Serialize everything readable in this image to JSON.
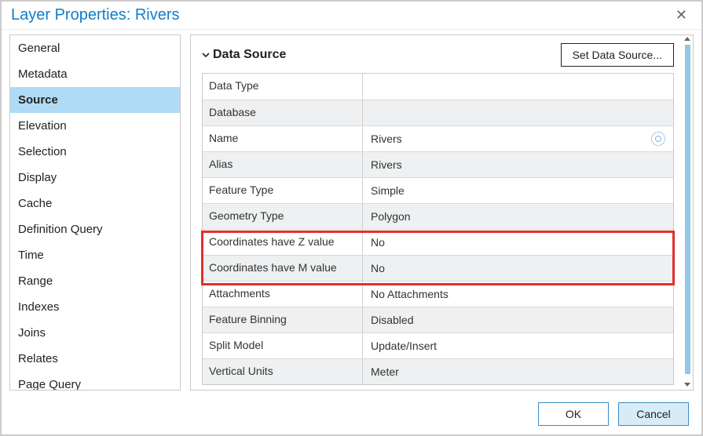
{
  "title": "Layer Properties: Rivers",
  "sidebar": {
    "items": [
      {
        "label": "General"
      },
      {
        "label": "Metadata"
      },
      {
        "label": "Source"
      },
      {
        "label": "Elevation"
      },
      {
        "label": "Selection"
      },
      {
        "label": "Display"
      },
      {
        "label": "Cache"
      },
      {
        "label": "Definition Query"
      },
      {
        "label": "Time"
      },
      {
        "label": "Range"
      },
      {
        "label": "Indexes"
      },
      {
        "label": "Joins"
      },
      {
        "label": "Relates"
      },
      {
        "label": "Page Query"
      }
    ],
    "active_index": 2
  },
  "main": {
    "section_title": "Data Source",
    "set_source_label": "Set Data Source...",
    "rows": [
      {
        "label": "Data Type",
        "value": ""
      },
      {
        "label": "Database",
        "value": ""
      },
      {
        "label": "Name",
        "value": "Rivers"
      },
      {
        "label": "Alias",
        "value": "Rivers"
      },
      {
        "label": "Feature Type",
        "value": "Simple"
      },
      {
        "label": "Geometry Type",
        "value": "Polygon"
      },
      {
        "label": "Coordinates have Z value",
        "value": "No"
      },
      {
        "label": "Coordinates have M value",
        "value": "No"
      },
      {
        "label": "Attachments",
        "value": "No Attachments"
      },
      {
        "label": "Feature Binning",
        "value": "Disabled"
      },
      {
        "label": "Split Model",
        "value": "Update/Insert"
      },
      {
        "label": "Vertical Units",
        "value": "Meter"
      }
    ],
    "highlight_rows": [
      6,
      7
    ]
  },
  "footer": {
    "ok_label": "OK",
    "cancel_label": "Cancel"
  }
}
